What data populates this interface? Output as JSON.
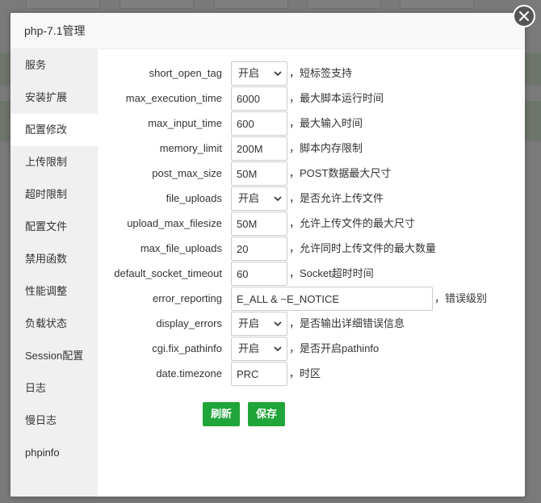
{
  "modal": {
    "title": "php-7.1管理"
  },
  "sidebar": {
    "items": [
      {
        "label": "服务"
      },
      {
        "label": "安装扩展"
      },
      {
        "label": "配置修改"
      },
      {
        "label": "上传限制"
      },
      {
        "label": "超时限制"
      },
      {
        "label": "配置文件"
      },
      {
        "label": "禁用函数"
      },
      {
        "label": "性能调整"
      },
      {
        "label": "负载状态"
      },
      {
        "label": "Session配置"
      },
      {
        "label": "日志"
      },
      {
        "label": "慢日志"
      },
      {
        "label": "phpinfo"
      }
    ],
    "active": "配置修改"
  },
  "config": {
    "rows": [
      {
        "key": "short_open_tag",
        "type": "select",
        "value": "开启",
        "desc": "，短标签支持"
      },
      {
        "key": "max_execution_time",
        "type": "input",
        "value": "6000",
        "desc": "，最大脚本运行时间"
      },
      {
        "key": "max_input_time",
        "type": "input",
        "value": "600",
        "desc": "，最大输入时间"
      },
      {
        "key": "memory_limit",
        "type": "input",
        "value": "200M",
        "desc": "，脚本内存限制"
      },
      {
        "key": "post_max_size",
        "type": "input",
        "value": "50M",
        "desc": "，POST数据最大尺寸"
      },
      {
        "key": "file_uploads",
        "type": "select",
        "value": "开启",
        "desc": "，是否允许上传文件"
      },
      {
        "key": "upload_max_filesize",
        "type": "input",
        "value": "50M",
        "desc": "，允许上传文件的最大尺寸"
      },
      {
        "key": "max_file_uploads",
        "type": "input",
        "value": "20",
        "desc": "，允许同时上传文件的最大数量"
      },
      {
        "key": "default_socket_timeout",
        "type": "input",
        "value": "60",
        "desc": "，Socket超时时间"
      },
      {
        "key": "error_reporting",
        "type": "input-wide",
        "value": "E_ALL & ~E_NOTICE",
        "desc": "，错误级别"
      },
      {
        "key": "display_errors",
        "type": "select",
        "value": "开启",
        "desc": "，是否输出详细错误信息"
      },
      {
        "key": "cgi.fix_pathinfo",
        "type": "select",
        "value": "开启",
        "desc": "，是否开启pathinfo"
      },
      {
        "key": "date.timezone",
        "type": "input",
        "value": "PRC",
        "desc": "，时区"
      }
    ]
  },
  "buttons": {
    "refresh": "刷新",
    "save": "保存"
  },
  "colors": {
    "accent": "#20a53a",
    "sidebar_bg": "#f0f0f0",
    "overlay": "rgba(0,0,0,0.5)"
  },
  "icons": {
    "close": "close-icon",
    "select_arrow": "chevron-down-icon"
  }
}
